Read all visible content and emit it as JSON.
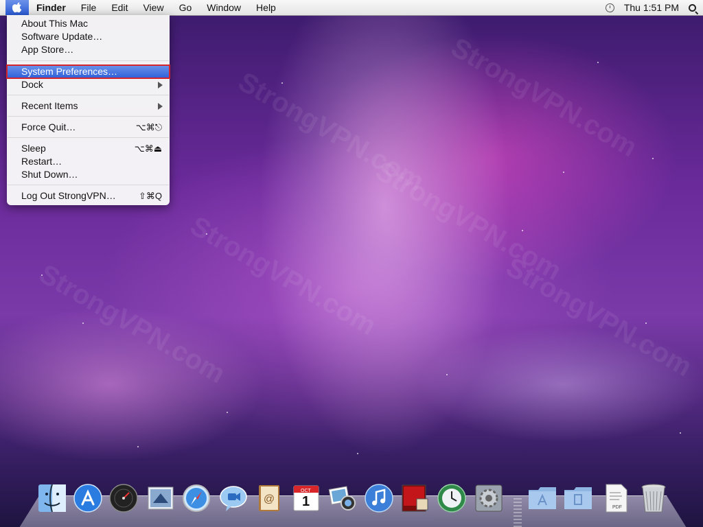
{
  "menubar": {
    "apple_icon": "apple-icon",
    "items": [
      {
        "label": "Finder",
        "bold": true
      },
      {
        "label": "File"
      },
      {
        "label": "Edit"
      },
      {
        "label": "View"
      },
      {
        "label": "Go"
      },
      {
        "label": "Window"
      },
      {
        "label": "Help"
      }
    ],
    "clock": "Thu 1:51 PM",
    "time_machine_icon": "time-machine-icon",
    "spotlight_icon": "spotlight-search-icon"
  },
  "apple_menu": {
    "items": [
      {
        "label": "About This Mac"
      },
      {
        "label": "Software Update…"
      },
      {
        "label": "App Store…"
      },
      {
        "label": "System Preferences…",
        "selected": true
      },
      {
        "label": "Dock",
        "submenu": true
      },
      {
        "label": "Recent Items",
        "submenu": true
      },
      {
        "label": "Force Quit…",
        "shortcut": "⌥⌘⎋"
      },
      {
        "label": "Sleep",
        "shortcut": "⌥⌘⏏"
      },
      {
        "label": "Restart…"
      },
      {
        "label": "Shut Down…"
      },
      {
        "label": "Log Out StrongVPN…",
        "shortcut": "⇧⌘Q"
      }
    ]
  },
  "dock": {
    "apps": [
      "finder-icon",
      "app-store-icon",
      "dashboard-icon",
      "mail-icon",
      "safari-icon",
      "ichat-icon",
      "address-book-icon",
      "ical-icon",
      "iphoto-icon",
      "itunes-icon",
      "front-row-icon",
      "time-machine-icon",
      "system-preferences-icon"
    ],
    "ical_month": "OCT",
    "ical_day": "1",
    "stacks": [
      "applications-folder-icon",
      "documents-folder-icon",
      "pdf-document-icon",
      "trash-icon"
    ],
    "pdf_label": "PDF"
  },
  "watermark": "StrongVPN.com",
  "colors": {
    "selection": "#3a6ad9",
    "highlight_box": "#d6242c"
  }
}
